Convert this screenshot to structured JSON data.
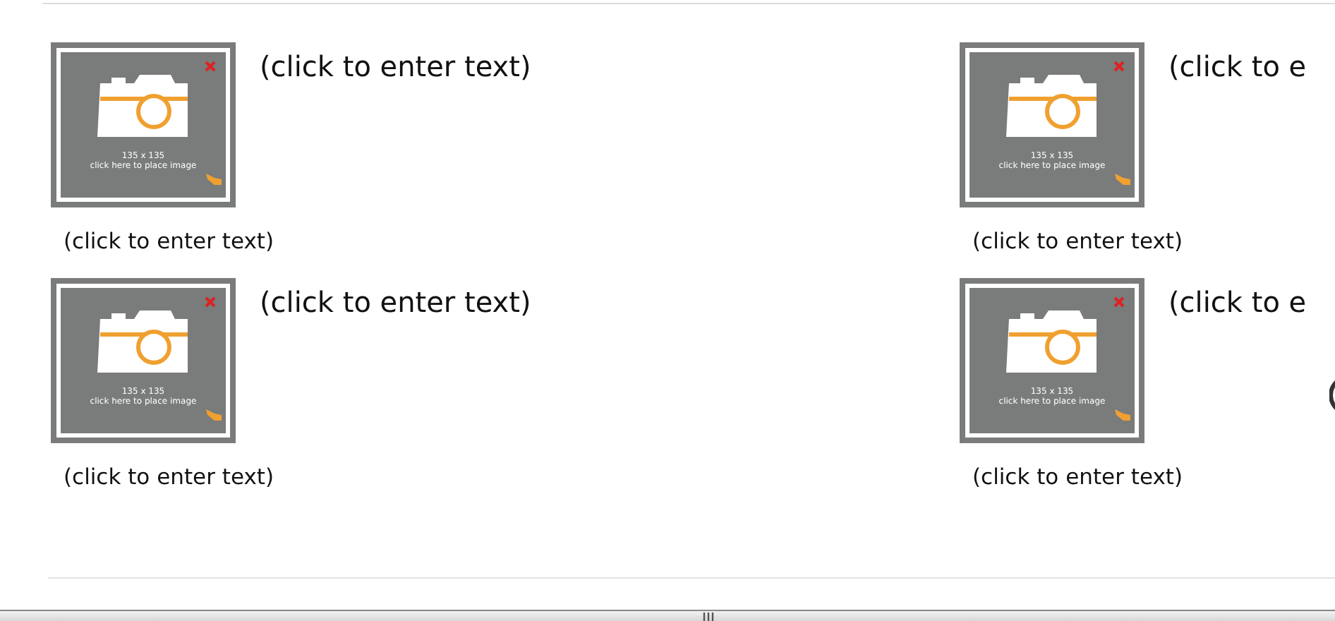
{
  "cells": [
    {
      "title": "(click to enter text)",
      "caption": "(click to enter text)",
      "image": {
        "size": "135 x 135",
        "hint": "click here to place image"
      }
    },
    {
      "title": "(click to e",
      "caption": "(click to enter text)",
      "image": {
        "size": "135 x 135",
        "hint": "click here to place image"
      }
    },
    {
      "title": "(click to enter text)",
      "caption": "(click to enter text)",
      "image": {
        "size": "135 x 135",
        "hint": "click here to place image"
      }
    },
    {
      "title": "(click to e",
      "caption": "(click to enter text)",
      "image": {
        "size": "135 x 135",
        "hint": "click here to place image"
      }
    }
  ]
}
